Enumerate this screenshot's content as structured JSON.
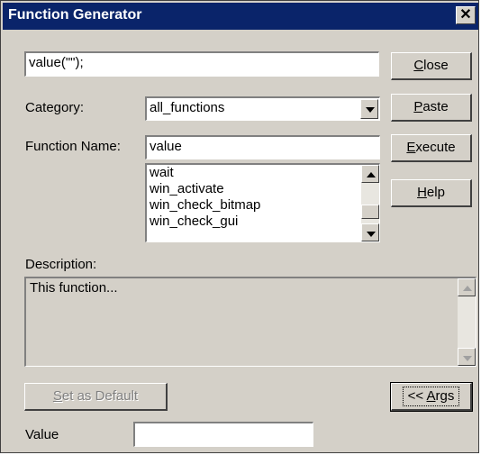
{
  "window": {
    "title": "Function Generator",
    "close_glyph": "✕"
  },
  "expression": {
    "value": "value(\"\");"
  },
  "category": {
    "label": "Category:",
    "selected": "all_functions"
  },
  "function_name": {
    "label": "Function Name:",
    "value": "value",
    "list_items": [
      "wait",
      "win_activate",
      "win_check_bitmap",
      "win_check_gui"
    ]
  },
  "buttons": {
    "close": {
      "mnemonic": "C",
      "rest": "lose"
    },
    "paste": {
      "mnemonic": "P",
      "rest": "aste"
    },
    "execute": {
      "mnemonic": "E",
      "rest": "xecute"
    },
    "help": {
      "mnemonic": "H",
      "rest": "elp"
    },
    "set_default": {
      "mnemonic": "S",
      "rest": "et as Default"
    },
    "args": {
      "prefix": "<< ",
      "mnemonic": "A",
      "rest": "rgs"
    }
  },
  "description": {
    "label": "Description:",
    "text": "This function..."
  },
  "value_field": {
    "label": "Value",
    "value": ""
  }
}
